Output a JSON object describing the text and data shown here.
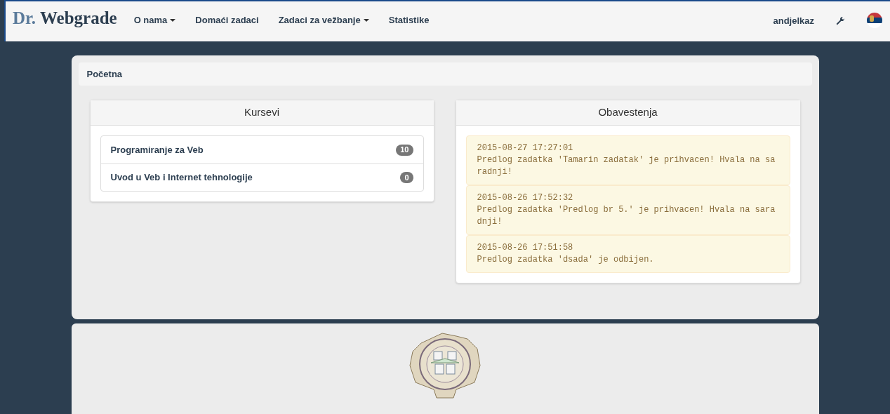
{
  "navbar": {
    "brand_prefix": "Dr.",
    "brand_name": "Webgrade",
    "menu": [
      {
        "label": "O nama",
        "dropdown": true
      },
      {
        "label": "Domaći zadaci",
        "dropdown": false
      },
      {
        "label": "Zadaci za vežbanje",
        "dropdown": true
      },
      {
        "label": "Statistike",
        "dropdown": false
      }
    ],
    "user": "andjelkaz"
  },
  "breadcrumb": "Početna",
  "courses": {
    "title": "Kursevi",
    "items": [
      {
        "name": "Programiranje za Veb",
        "count": "10"
      },
      {
        "name": "Uvod u Veb i Internet tehnologije",
        "count": "0"
      }
    ]
  },
  "notifications": {
    "title": "Obavestenja",
    "items": [
      {
        "time": "2015-08-27 17:27:01",
        "message": "Predlog zadatka 'Tamarin zadatak' je prihvacen! Hvala na saradnji!"
      },
      {
        "time": "2015-08-26 17:52:32",
        "message": "Predlog zadatka 'Predlog br 5.' je prihvacen! Hvala na saradnji!"
      },
      {
        "time": "2015-08-26 17:51:58",
        "message": "Predlog zadatka 'dsada' je odbijen."
      }
    ]
  }
}
